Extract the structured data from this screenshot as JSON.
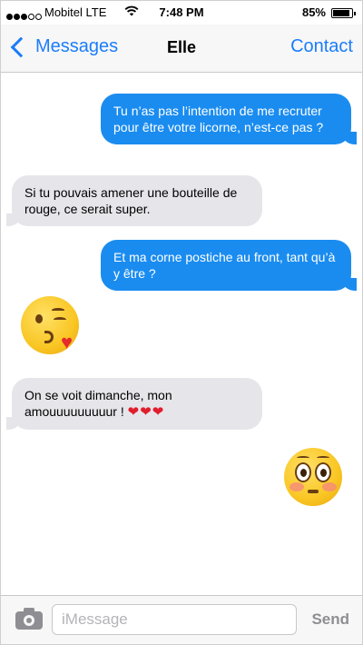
{
  "status_bar": {
    "carrier": "Mobitel LTE",
    "time": "7:48 PM",
    "battery_percent": "85%",
    "battery_level": 0.85,
    "signal_bars": 3,
    "signal_total": 5
  },
  "nav": {
    "back_label": "Messages",
    "title": "Elle",
    "contact_label": "Contact"
  },
  "messages": [
    {
      "type": "sent",
      "text": "Tu n’as pas l’intention de me recruter pour être votre licorne, n’est-ce pas ?"
    },
    {
      "type": "received",
      "text": "Si tu pouvais amener une bouteille de rouge, ce serait super."
    },
    {
      "type": "sent",
      "text": "Et ma corne postiche au front, tant qu’à y être ?"
    },
    {
      "type": "received-emoji",
      "emoji": "face-blowing-a-kiss"
    },
    {
      "type": "received",
      "text": "On se voit dimanche, mon amouuuuuuuuur !",
      "hearts": "❤❤❤"
    },
    {
      "type": "sent-emoji",
      "emoji": "flushed-face"
    }
  ],
  "input": {
    "placeholder": "iMessage",
    "value": "",
    "send_label": "Send"
  },
  "colors": {
    "accent": "#1a7dfa",
    "sent_bubble": "#1a8cf0",
    "received_bubble": "#e6e5ea"
  }
}
